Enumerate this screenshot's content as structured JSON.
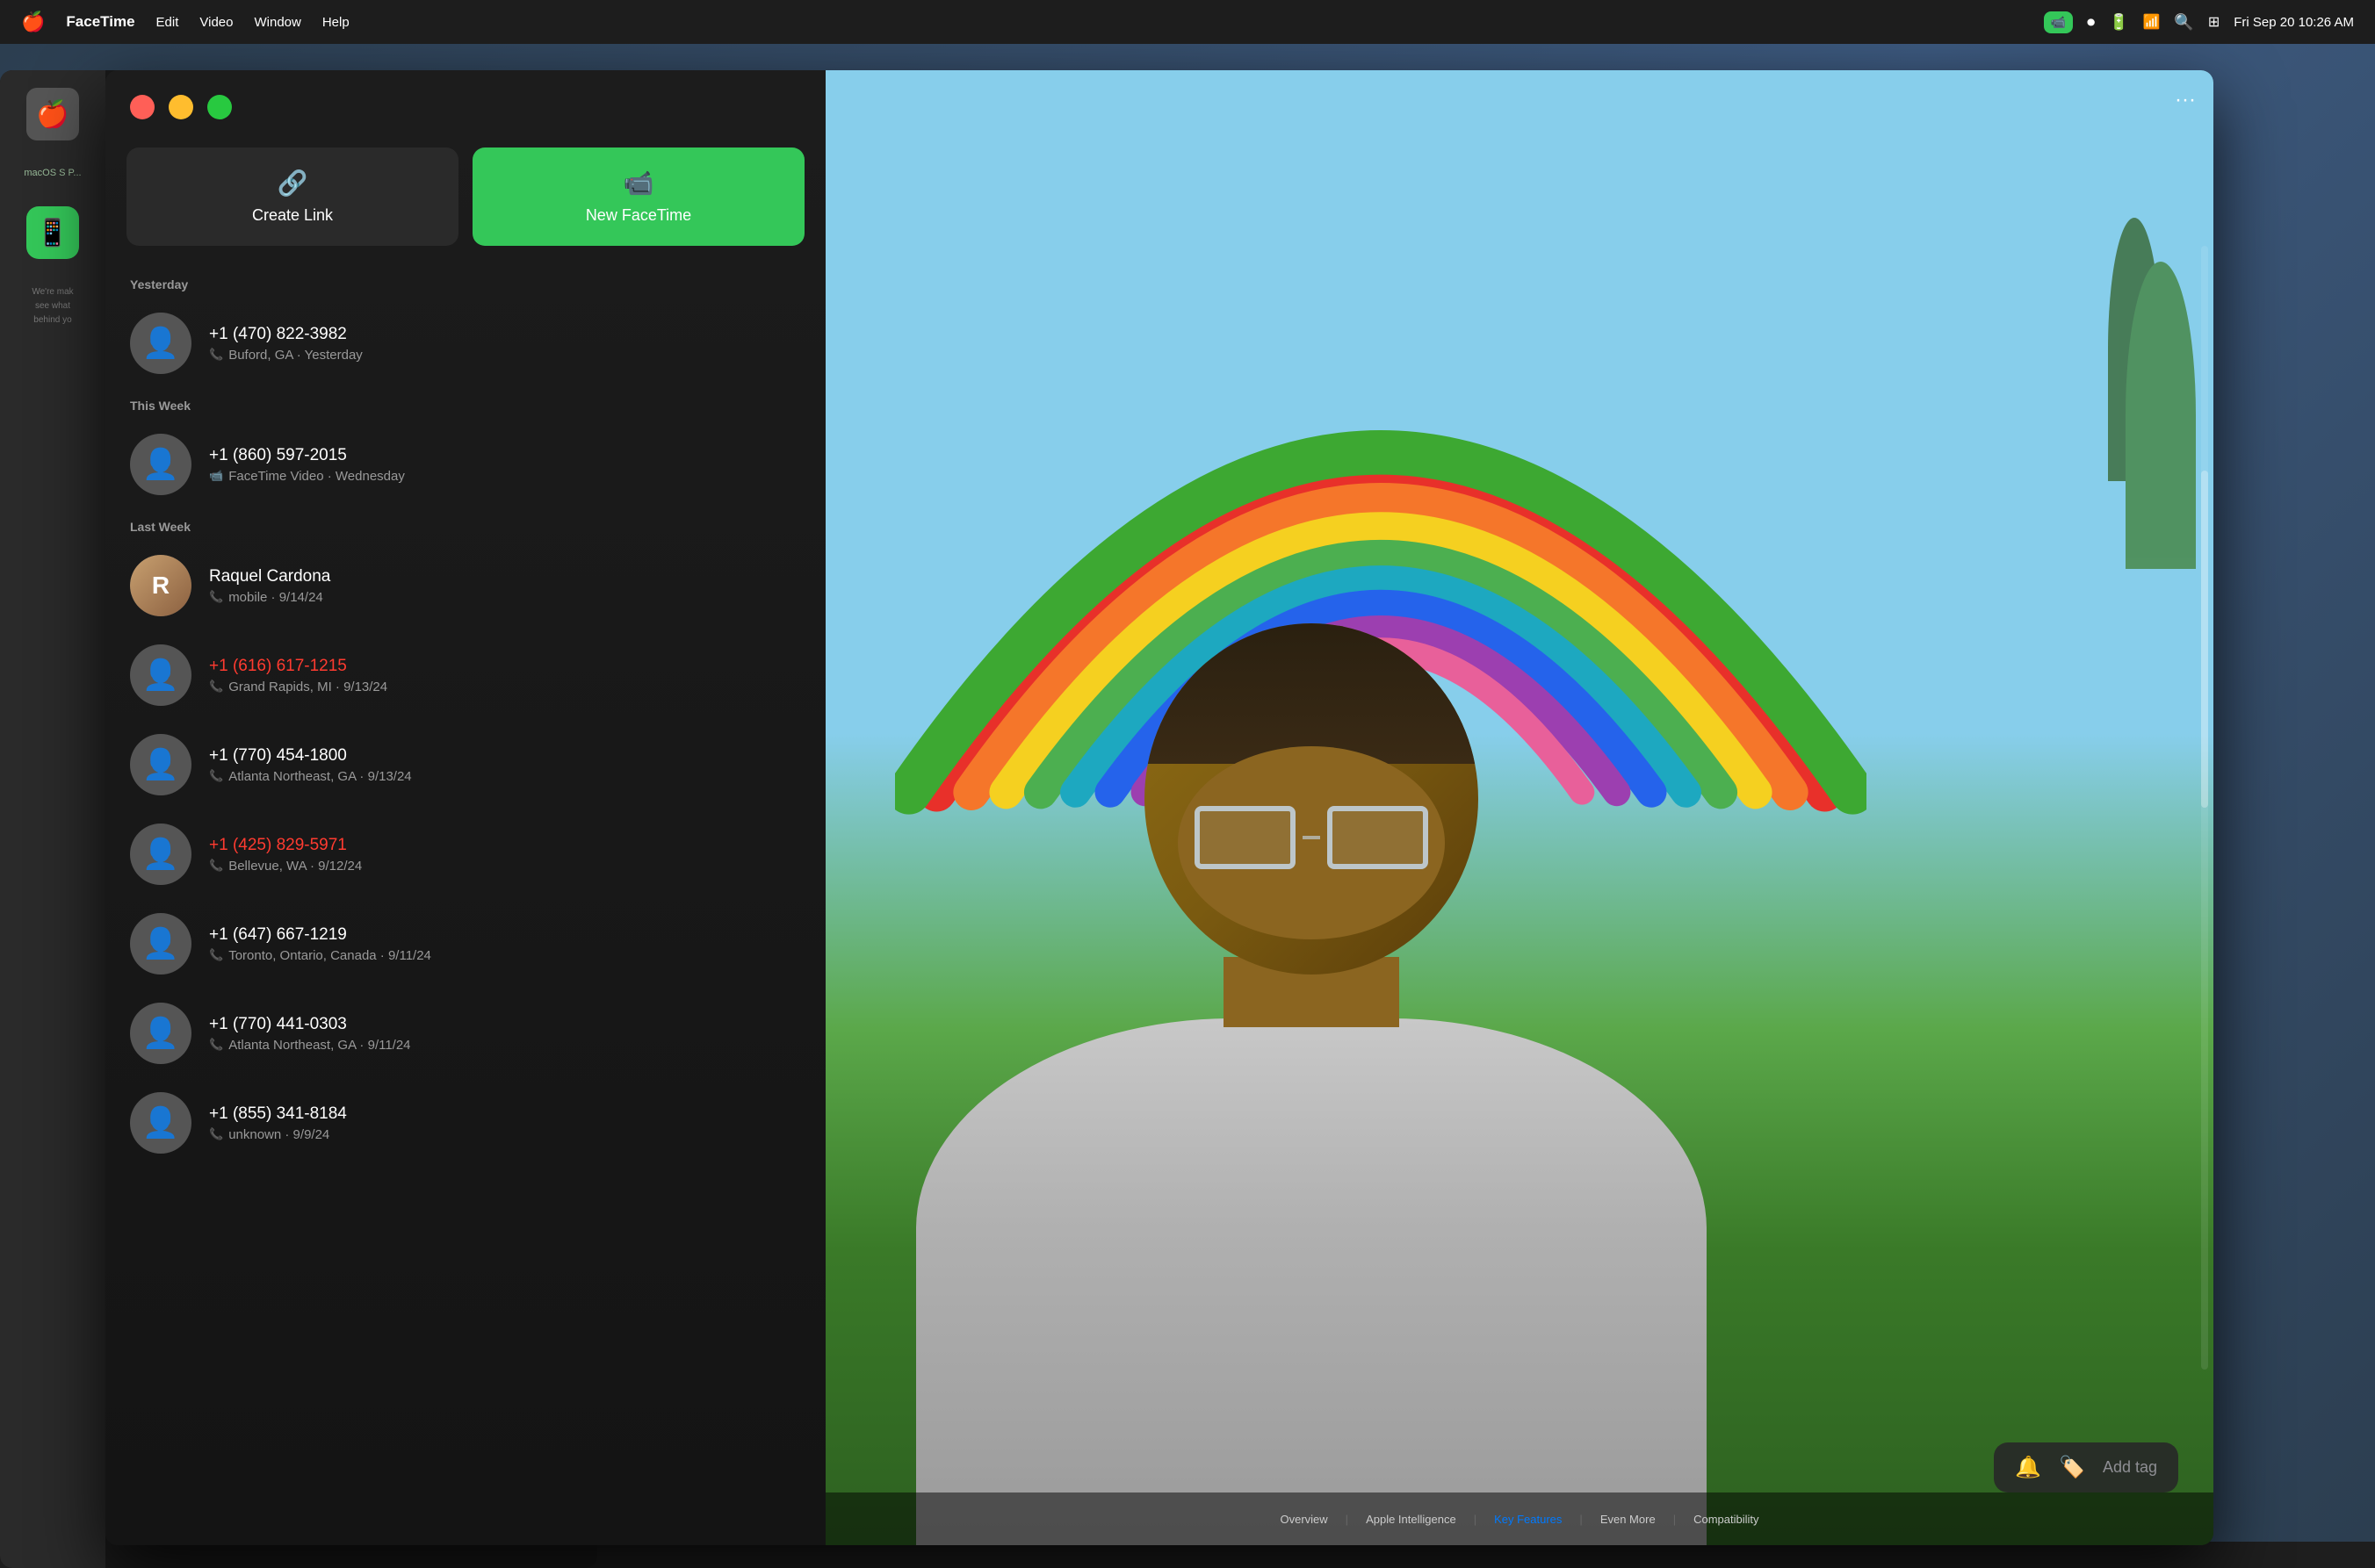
{
  "menubar": {
    "apple_icon": "🍎",
    "app_name": "FaceTime",
    "menu_items": [
      "Edit",
      "Video",
      "Window",
      "Help"
    ],
    "right_items": {
      "camera_label": "📷",
      "battery": "🔋",
      "wifi": "WiFi",
      "search": "🔍",
      "control_center": "⚙️",
      "datetime": "Fri Sep 20  10:26 AM"
    }
  },
  "facetime": {
    "window_title": "FaceTime",
    "buttons": {
      "create_link": "Create Link",
      "new_facetime": "New FaceTime",
      "create_link_icon": "🔗",
      "new_facetime_icon": "📹"
    },
    "sections": [
      {
        "label": "Yesterday",
        "calls": [
          {
            "name": "+1 (470) 822-3982",
            "detail": "Buford, GA · Yesterday",
            "type": "phone",
            "missed": false
          }
        ]
      },
      {
        "label": "This Week",
        "calls": [
          {
            "name": "+1 (860) 597-2015",
            "detail": "FaceTime Video · Wednesday",
            "type": "video",
            "missed": false
          }
        ]
      },
      {
        "label": "Last Week",
        "calls": [
          {
            "name": "Raquel Cardona",
            "detail": "mobile · 9/14/24",
            "type": "phone",
            "missed": false,
            "has_photo": true
          },
          {
            "name": "+1 (616) 617-1215",
            "detail": "Grand Rapids, MI · 9/13/24",
            "type": "phone",
            "missed": true
          },
          {
            "name": "+1 (770) 454-1800",
            "detail": "Atlanta Northeast, GA · 9/13/24",
            "type": "phone",
            "missed": false
          },
          {
            "name": "+1 (425) 829-5971",
            "detail": "Bellevue, WA · 9/12/24",
            "type": "phone",
            "missed": true
          },
          {
            "name": "+1 (647) 667-1219",
            "detail": "Toronto, Ontario, Canada · 9/11/24",
            "type": "phone",
            "missed": false
          },
          {
            "name": "+1 (770) 441-0303",
            "detail": "Atlanta Northeast, GA · 9/11/24",
            "type": "phone",
            "missed": false
          },
          {
            "name": "+1 (855) 341-8184",
            "detail": "unknown · 9/9/24",
            "type": "phone",
            "missed": false
          }
        ]
      }
    ]
  },
  "bottom_bar": {
    "links": [
      "Overview",
      "Apple Intelligence",
      "Key Features",
      "Even More",
      "Compatibility"
    ]
  },
  "notification": {
    "bell_icon": "🔔",
    "tag_icon": "🏷️",
    "add_tag_text": "Add tag"
  },
  "bg_sidebar": {
    "apple_icon": "🍎",
    "app_icon": "📱",
    "text_lines": [
      "We're mak",
      "see what",
      "behind yo"
    ]
  }
}
